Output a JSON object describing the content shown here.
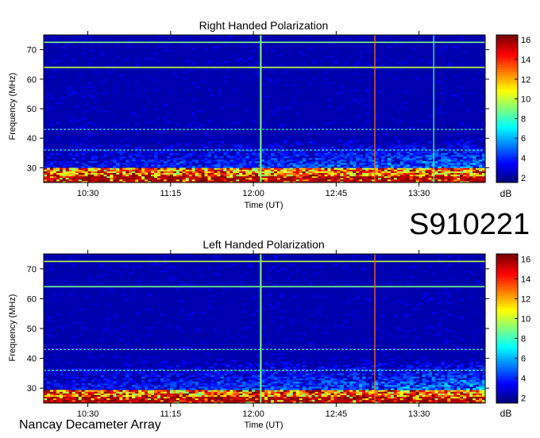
{
  "observation_id": "S910221",
  "credit": "Nancay Decameter Array",
  "chart_data": [
    {
      "type": "heatmap",
      "title": "Right Handed Polarization",
      "xlabel": "Time (UT)",
      "ylabel": "Frequency (MHz)",
      "x_tick_labels": [
        "10:30",
        "11:15",
        "12:00",
        "12:45",
        "13:30"
      ],
      "x_tick_values_min": [
        630,
        675,
        720,
        765,
        810
      ],
      "xlim_min": [
        606,
        846
      ],
      "y_ticks": [
        30,
        40,
        50,
        60,
        70
      ],
      "ylim": [
        25,
        75
      ],
      "colorbar": {
        "label": "dB",
        "ticks": [
          2,
          4,
          6,
          8,
          10,
          12,
          14,
          16
        ],
        "range": [
          1.5,
          16.5
        ]
      },
      "features": {
        "low_band_intense_below_mhz": 30,
        "horizontal_lines_mhz": [
          64,
          72.5,
          43,
          36
        ],
        "vertical_events_min": [
          724,
          786,
          818
        ]
      }
    },
    {
      "type": "heatmap",
      "title": "Left Handed Polarization",
      "xlabel": "Time (UT)",
      "ylabel": "Frequency (MHz)",
      "x_tick_labels": [
        "10:30",
        "11:15",
        "12:00",
        "12:45",
        "13:30"
      ],
      "x_tick_values_min": [
        630,
        675,
        720,
        765,
        810
      ],
      "xlim_min": [
        606,
        846
      ],
      "y_ticks": [
        30,
        40,
        50,
        60,
        70
      ],
      "ylim": [
        25,
        75
      ],
      "colorbar": {
        "label": "dB",
        "ticks": [
          2,
          4,
          6,
          8,
          10,
          12,
          14,
          16
        ],
        "range": [
          1.5,
          16.5
        ]
      },
      "features": {
        "low_band_intense_below_mhz": 29,
        "horizontal_lines_mhz": [
          72.5,
          64,
          43,
          36
        ],
        "vertical_events_min": [
          724,
          786
        ]
      }
    }
  ]
}
